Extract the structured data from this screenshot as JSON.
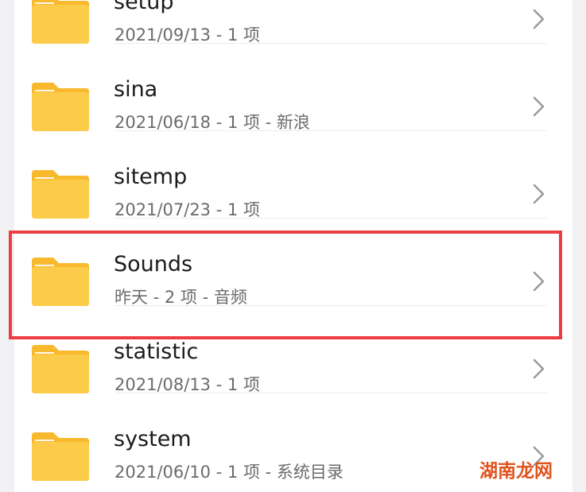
{
  "folders": [
    {
      "name": "setup",
      "meta": "2021/09/13 - 1 项"
    },
    {
      "name": "sina",
      "meta": "2021/06/18 - 1 项 - 新浪"
    },
    {
      "name": "sitemp",
      "meta": "2021/07/23 - 1 项"
    },
    {
      "name": "Sounds",
      "meta": "昨天 - 2 项 - 音频"
    },
    {
      "name": "statistic",
      "meta": "2021/08/13 - 1 项"
    },
    {
      "name": "system",
      "meta": "2021/06/10 - 1 项 - 系统目录"
    }
  ],
  "highlight_color": "#ec3c44",
  "folder_color": "#fccb4a",
  "icons": {
    "folder": "folder-icon",
    "chevron": "chevron-right-icon"
  },
  "watermark": {
    "text": "湖南龙网"
  }
}
